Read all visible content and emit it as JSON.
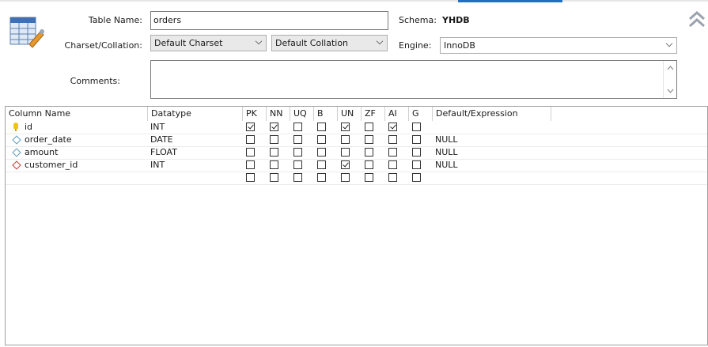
{
  "form": {
    "table_name_label": "Table Name:",
    "table_name_value": "orders",
    "schema_label": "Schema:",
    "schema_value": "YHDB",
    "charset_label": "Charset/Collation:",
    "charset_value": "Default Charset",
    "collation_value": "Default Collation",
    "engine_label": "Engine:",
    "engine_value": "InnoDB",
    "comments_label": "Comments:",
    "comments_value": ""
  },
  "columns_header": [
    "Column Name",
    "Datatype",
    "PK",
    "NN",
    "UQ",
    "B",
    "UN",
    "ZF",
    "AI",
    "G",
    "Default/Expression"
  ],
  "rows": [
    {
      "name": "id",
      "icon": "primary-key-icon",
      "type": "INT",
      "flags": [
        true,
        true,
        false,
        false,
        true,
        false,
        true,
        false
      ],
      "default": ""
    },
    {
      "name": "order_date",
      "icon": "column-diamond-icon",
      "type": "DATE",
      "flags": [
        false,
        false,
        false,
        false,
        false,
        false,
        false,
        false
      ],
      "default": "NULL"
    },
    {
      "name": "amount",
      "icon": "column-diamond-icon",
      "type": "FLOAT",
      "flags": [
        false,
        false,
        false,
        false,
        false,
        false,
        false,
        false
      ],
      "default": "NULL"
    },
    {
      "name": "customer_id",
      "icon": "foreign-key-diamond-icon",
      "type": "INT",
      "flags": [
        false,
        false,
        false,
        false,
        true,
        false,
        false,
        false
      ],
      "default": "NULL"
    },
    {
      "name": "",
      "icon": "",
      "type": "",
      "flags": [
        false,
        false,
        false,
        false,
        false,
        false,
        false,
        false
      ],
      "default": ""
    }
  ],
  "colors": {
    "accent": "#1f6fc4",
    "diamond_regular": "#5b9bbd",
    "diamond_foreign": "#c0392b",
    "key": "#f1c40f"
  }
}
